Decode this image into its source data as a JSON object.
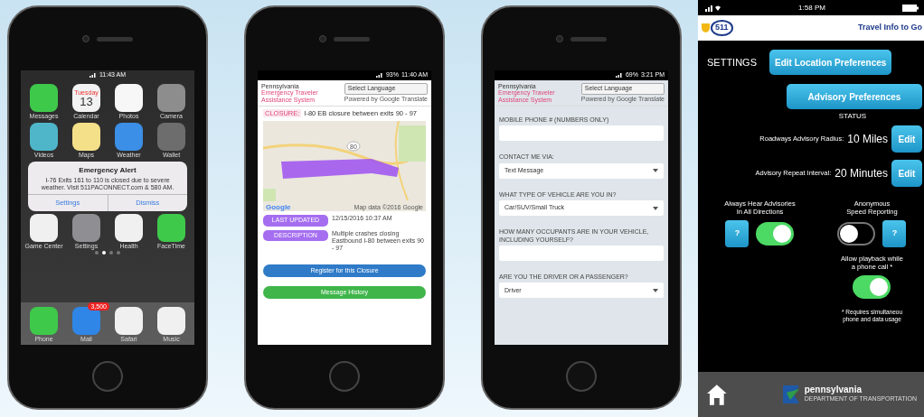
{
  "home_screen": {
    "status_time": "11:43 AM",
    "apps": [
      {
        "label": "Messages"
      },
      {
        "label": "Calendar",
        "day": "Tuesday",
        "date": "13"
      },
      {
        "label": "Photos"
      },
      {
        "label": "Camera"
      },
      {
        "label": "Videos"
      },
      {
        "label": "Maps"
      },
      {
        "label": "Weather"
      },
      {
        "label": "Wallet"
      }
    ],
    "alert": {
      "title": "Emergency Alert",
      "message": "I-76 Exits 161 to 110 is closed due to severe weather. Visit 511PACONNECT.com & 580 AM.",
      "buttons": [
        "Settings",
        "Dismiss"
      ]
    },
    "apps_lower": [
      {
        "label": "Game Center"
      },
      {
        "label": "Settings"
      },
      {
        "label": "Health"
      },
      {
        "label": "FaceTime"
      }
    ],
    "page_dots": [
      {
        "selected": false
      },
      {
        "selected": true
      },
      {
        "selected": false
      },
      {
        "selected": false
      }
    ],
    "dock": [
      {
        "label": "Phone"
      },
      {
        "label": "Mail",
        "badge": "3,500"
      },
      {
        "label": "Safari"
      },
      {
        "label": "Music"
      }
    ]
  },
  "incident_screen": {
    "status_time": "11:40 AM",
    "battery": "93%",
    "site_title": {
      "state": "Pennsylvania",
      "system": "Emergency Traveler Assistance System"
    },
    "language": {
      "value": "Select Language",
      "powered_by": "Powered by Google Translate"
    },
    "incident": {
      "tag": "CLOSURE:",
      "title": "I-80 EB closure between exits 90 - 97"
    },
    "map": {
      "route_number": "80",
      "logo": "Google",
      "attribution": "Map data ©2016 Google"
    },
    "details": [
      {
        "label": "LAST UPDATED",
        "value": "12/15/2016 10:37 AM"
      },
      {
        "label": "DESCRIPTION",
        "value": "Multiple crashes closing Eastbound I-80 between exits 90 - 97"
      }
    ],
    "buttons": [
      {
        "label": "Register for this Closure",
        "kind": "primary"
      },
      {
        "label": "Message History",
        "kind": "success"
      }
    ]
  },
  "form_screen": {
    "status_time": "3:21 PM",
    "battery": "69%",
    "site_title": {
      "state": "Pennsylvania",
      "system": "Emergency Traveler Assistance System"
    },
    "language": {
      "value": "Select Language",
      "powered_by": "Powered by Google Translate"
    },
    "fields": [
      {
        "kind": "input",
        "label": "MOBILE PHONE #",
        "hint": "(NUMBERS ONLY)"
      },
      {
        "kind": "select",
        "label": "CONTACT ME VIA:",
        "value": "Text Message"
      },
      {
        "kind": "select",
        "label": "WHAT TYPE OF VEHICLE ARE YOU IN?",
        "value": "Car/SUV/Small Truck"
      },
      {
        "kind": "input",
        "label": "HOW MANY OCCUPANTS ARE IN YOUR VEHICLE, INCLUDING YOURSELF?"
      },
      {
        "kind": "select",
        "label": "ARE YOU THE DRIVER OR A PASSENGER?",
        "value": "Driver"
      }
    ]
  },
  "settings_screen": {
    "status_time": "1:58 PM",
    "logo": "511",
    "header_title": "Travel Info to Go",
    "heading": "SETTINGS",
    "buttons": [
      "Edit Location Preferences",
      "Advisory Preferences"
    ],
    "status_heading": "STATUS",
    "status_rows": [
      {
        "label": "Roadways Advisory Radius:",
        "value": "10 Miles",
        "action": "Edit"
      },
      {
        "label": "Advisory Repeat Interval:",
        "value": "20 Minutes",
        "action": "Edit"
      }
    ],
    "toggles": [
      {
        "label_lines": [
          "Always Hear Advisories",
          "In All Directions"
        ],
        "on": true,
        "help": "?"
      },
      {
        "label_lines": [
          "Anonymous",
          "Speed Reporting"
        ],
        "on": false,
        "help": "?"
      },
      {
        "label_lines": [
          "Allow playback while",
          "a phone call *"
        ],
        "on": true
      }
    ],
    "note_lines": [
      "* Requires simultaneou",
      "phone and data usage"
    ],
    "footer": {
      "org": "pennsylvania",
      "dept": "DEPARTMENT OF TRANSPORTATION"
    }
  }
}
